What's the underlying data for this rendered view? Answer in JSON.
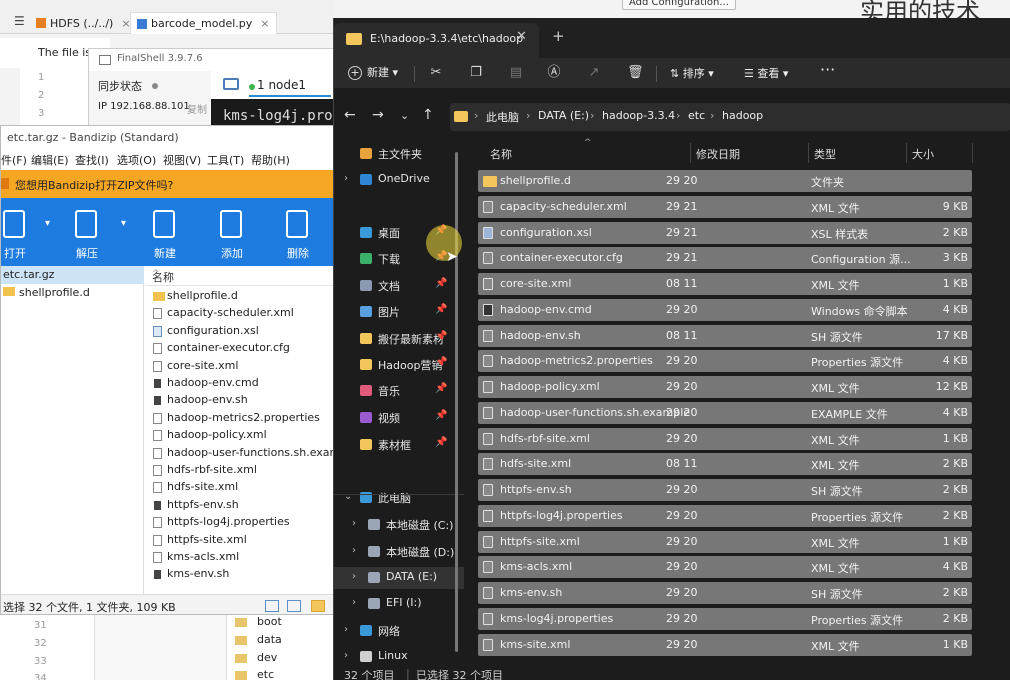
{
  "ide": {
    "menu_glyph": "☰",
    "tabs": [
      {
        "label": "HDFS (../../)",
        "color": "#e67e22"
      },
      {
        "label": "barcode_model.py",
        "color": "#3a7bd5"
      }
    ],
    "notice": "The file is id",
    "gutter": [
      "1",
      "2",
      "3"
    ],
    "add_config": "Add Configuration...",
    "top_right_text": "实用的技术",
    "bottom_gutter": [
      "31",
      "32",
      "33",
      "34"
    ],
    "bottom_tree": [
      "boot",
      "data",
      "dev",
      "etc"
    ]
  },
  "finalshell": {
    "title": "FinalShell 3.9.7.6",
    "sync_label": "同步状态",
    "ip_label": "IP 192.168.88.101",
    "copy_label": "复制",
    "tab_label": "1 node1",
    "terminal_text": "kms-log4j.pro"
  },
  "bandizip": {
    "title": "etc.tar.gz - Bandizip (Standard)",
    "menu": [
      "件(F)",
      "编辑(E)",
      "查找(I)",
      "选项(O)",
      "视图(V)",
      "工具(T)",
      "帮助(H)"
    ],
    "banner": "您想用Bandizip打开ZIP文件吗?",
    "tools": [
      "打开",
      "解压",
      "新建",
      "添加",
      "删除"
    ],
    "tree_root": "etc.tar.gz",
    "tree_child": "shellprofile.d",
    "list_header": "名称",
    "files": [
      {
        "name": "shellprofile.d",
        "kind": "folder"
      },
      {
        "name": "capacity-scheduler.xml",
        "kind": "doc"
      },
      {
        "name": "configuration.xsl",
        "kind": "xsl"
      },
      {
        "name": "container-executor.cfg",
        "kind": "doc"
      },
      {
        "name": "core-site.xml",
        "kind": "doc"
      },
      {
        "name": "hadoop-env.cmd",
        "kind": "cmd"
      },
      {
        "name": "hadoop-env.sh",
        "kind": "sh"
      },
      {
        "name": "hadoop-metrics2.properties",
        "kind": "doc"
      },
      {
        "name": "hadoop-policy.xml",
        "kind": "doc"
      },
      {
        "name": "hadoop-user-functions.sh.example",
        "kind": "doc"
      },
      {
        "name": "hdfs-rbf-site.xml",
        "kind": "doc"
      },
      {
        "name": "hdfs-site.xml",
        "kind": "doc"
      },
      {
        "name": "httpfs-env.sh",
        "kind": "sh"
      },
      {
        "name": "httpfs-log4j.properties",
        "kind": "doc"
      },
      {
        "name": "httpfs-site.xml",
        "kind": "doc"
      },
      {
        "name": "kms-acls.xml",
        "kind": "doc"
      },
      {
        "name": "kms-env.sh",
        "kind": "sh"
      }
    ],
    "status": "选择 32 个文件, 1 文件夹, 109 KB"
  },
  "explorer": {
    "tab_title": "E:\\hadoop-3.3.4\\etc\\hadoop",
    "new_label": "新建",
    "sort_label": "排序",
    "view_label": "查看",
    "more_label": "···",
    "crumbs": [
      "此电脑",
      "DATA (E:)",
      "hadoop-3.3.4",
      "etc",
      "hadoop"
    ],
    "nav": [
      {
        "label": "主文件夹",
        "color": "#e8a33c"
      },
      {
        "label": "OneDrive",
        "color": "#2f86d6"
      },
      {
        "label": "桌面",
        "color": "#3a9ad9"
      },
      {
        "label": "下载",
        "color": "#3bb06a"
      },
      {
        "label": "文档",
        "color": "#8a98b0"
      },
      {
        "label": "图片",
        "color": "#5aa0e0"
      },
      {
        "label": "搬仔最新素材",
        "color": "#f3c65b"
      },
      {
        "label": "Hadoop营销",
        "color": "#f3c65b"
      },
      {
        "label": "音乐",
        "color": "#e05a7a"
      },
      {
        "label": "视频",
        "color": "#9a5ad0"
      },
      {
        "label": "素材框",
        "color": "#f3c65b"
      },
      {
        "label": "此电脑",
        "color": "#3a9ad9"
      },
      {
        "label": "本地磁盘 (C:)",
        "color": "#9aa5b5"
      },
      {
        "label": "本地磁盘 (D:)",
        "color": "#9aa5b5"
      },
      {
        "label": "DATA (E:)",
        "color": "#9aa5b5"
      },
      {
        "label": "EFI (I:)",
        "color": "#9aa5b5"
      },
      {
        "label": "网络",
        "color": "#3a9ad9"
      },
      {
        "label": "Linux",
        "color": "#cfcfcf"
      }
    ],
    "columns": [
      "名称",
      "修改日期",
      "类型",
      "大小"
    ],
    "files": [
      {
        "name": "shellprofile.d",
        "date": "29 20",
        "type": "文件夹",
        "size": "",
        "kind": "folder"
      },
      {
        "name": "capacity-scheduler.xml",
        "date": "29 21",
        "type": "XML 文件",
        "size": "9 KB",
        "kind": "doc"
      },
      {
        "name": "configuration.xsl",
        "date": "29 21",
        "type": "XSL 样式表",
        "size": "2 KB",
        "kind": "xsl"
      },
      {
        "name": "container-executor.cfg",
        "date": "29 21",
        "type": "Configuration 源...",
        "size": "3 KB",
        "kind": "doc"
      },
      {
        "name": "core-site.xml",
        "date": "08 11",
        "type": "XML 文件",
        "size": "1 KB",
        "kind": "doc"
      },
      {
        "name": "hadoop-env.cmd",
        "date": "29 20",
        "type": "Windows 命令脚本",
        "size": "4 KB",
        "kind": "cmd"
      },
      {
        "name": "hadoop-env.sh",
        "date": "08 11",
        "type": "SH 源文件",
        "size": "17 KB",
        "kind": "doc"
      },
      {
        "name": "hadoop-metrics2.properties",
        "date": "29 20",
        "type": "Properties 源文件",
        "size": "4 KB",
        "kind": "doc"
      },
      {
        "name": "hadoop-policy.xml",
        "date": "29 20",
        "type": "XML 文件",
        "size": "12 KB",
        "kind": "doc"
      },
      {
        "name": "hadoop-user-functions.sh.example",
        "date": "29 20",
        "type": "EXAMPLE 文件",
        "size": "4 KB",
        "kind": "doc"
      },
      {
        "name": "hdfs-rbf-site.xml",
        "date": "29 20",
        "type": "XML 文件",
        "size": "1 KB",
        "kind": "doc"
      },
      {
        "name": "hdfs-site.xml",
        "date": "08 11",
        "type": "XML 文件",
        "size": "2 KB",
        "kind": "doc"
      },
      {
        "name": "httpfs-env.sh",
        "date": "29 20",
        "type": "SH 源文件",
        "size": "2 KB",
        "kind": "doc"
      },
      {
        "name": "httpfs-log4j.properties",
        "date": "29 20",
        "type": "Properties 源文件",
        "size": "2 KB",
        "kind": "doc"
      },
      {
        "name": "httpfs-site.xml",
        "date": "29 20",
        "type": "XML 文件",
        "size": "1 KB",
        "kind": "doc"
      },
      {
        "name": "kms-acls.xml",
        "date": "29 20",
        "type": "XML 文件",
        "size": "4 KB",
        "kind": "doc"
      },
      {
        "name": "kms-env.sh",
        "date": "29 20",
        "type": "SH 源文件",
        "size": "2 KB",
        "kind": "doc"
      },
      {
        "name": "kms-log4j.properties",
        "date": "29 20",
        "type": "Properties 源文件",
        "size": "2 KB",
        "kind": "doc"
      },
      {
        "name": "kms-site.xml",
        "date": "29 20",
        "type": "XML 文件",
        "size": "1 KB",
        "kind": "doc"
      }
    ],
    "status_items": "32 个项目",
    "status_selected": "已选择 32 个项目"
  }
}
